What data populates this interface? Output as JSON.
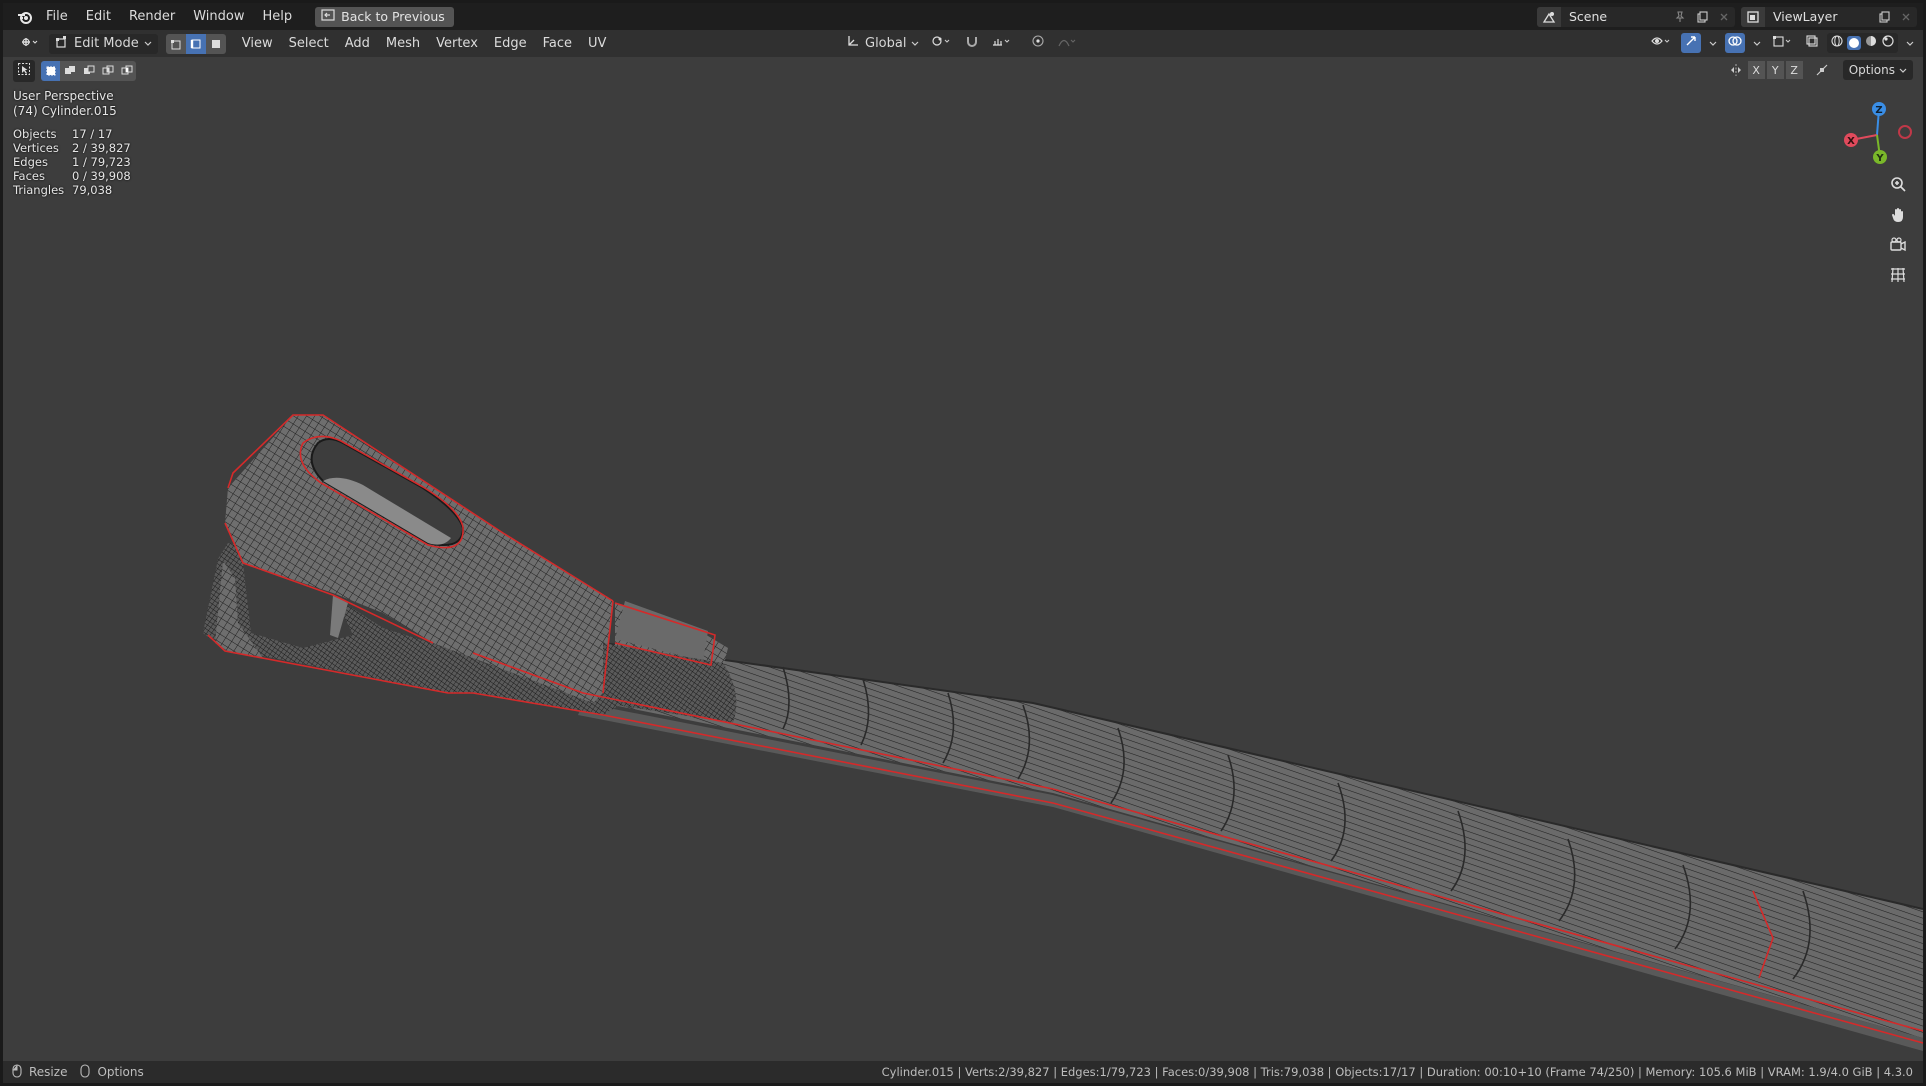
{
  "menubar": {
    "items": [
      "File",
      "Edit",
      "Render",
      "Window",
      "Help"
    ],
    "back_label": "Back to Previous",
    "scene_name": "Scene",
    "view_layer_name": "ViewLayer"
  },
  "header": {
    "mode_label": "Edit Mode",
    "menus": [
      "View",
      "Select",
      "Add",
      "Mesh",
      "Vertex",
      "Edge",
      "Face",
      "UV"
    ],
    "transform_orientation": "Global",
    "options_label": "Options",
    "axes": [
      "X",
      "Y",
      "Z"
    ]
  },
  "overlay": {
    "view_name": "User Perspective",
    "object_name": "(74) Cylinder.015",
    "stats": [
      {
        "label": "Objects",
        "value": "17 / 17"
      },
      {
        "label": "Vertices",
        "value": "2 / 39,827"
      },
      {
        "label": "Edges",
        "value": "1 / 79,723"
      },
      {
        "label": "Faces",
        "value": "0 / 39,908"
      },
      {
        "label": "Triangles",
        "value": "79,038"
      }
    ]
  },
  "gizmo": {
    "z": "Z",
    "x": "X",
    "y": "Y"
  },
  "statusbar": {
    "resize_label": "Resize",
    "options_label": "Options",
    "info": "Cylinder.015 | Verts:2/39,827 | Edges:1/79,723 | Faces:0/39,908 | Tris:79,038 | Objects:17/17 | Duration: 00:10+10 (Frame 74/250) | Memory: 105.6 MiB | VRAM: 1.9/4.0 GiB | 4.3.0"
  },
  "colors": {
    "accent": "#4772b3",
    "selection_edge": "#d42a2a",
    "viewport_bg": "#3d3d3d",
    "axis_x": "#e04a5c",
    "axis_y": "#7ab82a",
    "axis_z": "#3a8ee6"
  },
  "icons": [
    "blender-logo",
    "back-icon",
    "scene-icon",
    "pin-icon",
    "new-scene-icon",
    "view-layer-icon",
    "editor-type-icon",
    "select-box-icon",
    "vertex-select-icon",
    "edge-select-icon",
    "face-select-icon",
    "transform-orientation-icon",
    "pivot-icon",
    "snap-icon",
    "proportional-edit-icon",
    "visibility-icon",
    "gizmo-icon",
    "overlay-icon",
    "xray-icon",
    "shading-wireframe-icon",
    "shading-solid-icon",
    "shading-material-icon",
    "shading-rendered-icon",
    "zoom-icon",
    "pan-icon",
    "camera-icon",
    "ortho-grid-icon",
    "mouse-icon"
  ]
}
